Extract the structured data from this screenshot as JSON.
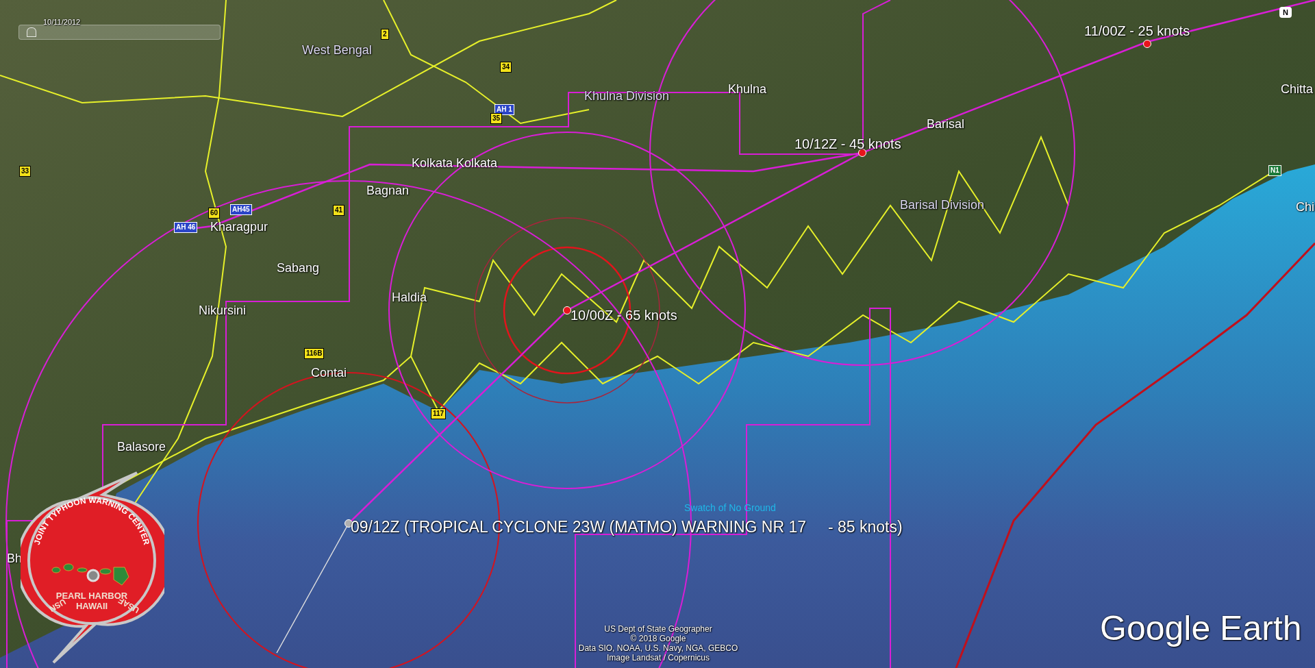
{
  "time_slider": {
    "date": "10/11/2012",
    "level": 0.04
  },
  "compass": {
    "label": "N"
  },
  "place_labels": [
    {
      "text": "West Bengal",
      "kind": "region"
    },
    {
      "text": "Khulna Division",
      "kind": "region"
    },
    {
      "text": "Khulna",
      "kind": "city"
    },
    {
      "text": "Barisal",
      "kind": "city"
    },
    {
      "text": "Barisal Division",
      "kind": "region"
    },
    {
      "text": "Kolkata Kolkata",
      "kind": "city"
    },
    {
      "text": "Bagnan",
      "kind": "city"
    },
    {
      "text": "Kharagpur",
      "kind": "city"
    },
    {
      "text": "Sabang",
      "kind": "city"
    },
    {
      "text": "Nikursini",
      "kind": "city"
    },
    {
      "text": "Haldia",
      "kind": "city"
    },
    {
      "text": "Contai",
      "kind": "city"
    },
    {
      "text": "Balasore",
      "kind": "city"
    },
    {
      "text": "Bh",
      "kind": "city"
    },
    {
      "text": "Chitta",
      "kind": "city"
    },
    {
      "text": "Chi",
      "kind": "city"
    },
    {
      "text": "Swatch of No Ground",
      "kind": "water"
    }
  ],
  "road_shields": [
    {
      "text": "2",
      "kind": "national"
    },
    {
      "text": "34",
      "kind": "national"
    },
    {
      "text": "AH 1",
      "kind": "asian"
    },
    {
      "text": "35",
      "kind": "national"
    },
    {
      "text": "33",
      "kind": "national"
    },
    {
      "text": "60",
      "kind": "national"
    },
    {
      "text": "AH45",
      "kind": "asian"
    },
    {
      "text": "AH 46",
      "kind": "asian"
    },
    {
      "text": "41",
      "kind": "national"
    },
    {
      "text": "116B",
      "kind": "national"
    },
    {
      "text": "117",
      "kind": "national"
    },
    {
      "text": "N1",
      "kind": "green"
    }
  ],
  "storm_track": [
    {
      "label": "11/00Z - 25 knots",
      "kind": "forecast"
    },
    {
      "label": "10/12Z - 45 knots",
      "kind": "forecast"
    },
    {
      "label": "10/00Z - 65 knots",
      "kind": "forecast"
    },
    {
      "label": "09/12Z (TROPICAL CYCLONE 23W (MATMO) WARNING NR 17     - 85 knots)",
      "kind": "current"
    }
  ],
  "logo": {
    "ring_text": "JOINT TYPHOON WARNING CENTER",
    "center_lines": [
      "PEARL HARBOR",
      "HAWAII"
    ],
    "left_text": "USN",
    "right_text": "USAF"
  },
  "attribution": [
    "US Dept of State Geographer",
    "© 2018 Google",
    "Data SIO, NOAA, U.S. Navy, NGA, GEBCO",
    "Image Landsat / Copernicus"
  ],
  "brand": "Google Earth"
}
